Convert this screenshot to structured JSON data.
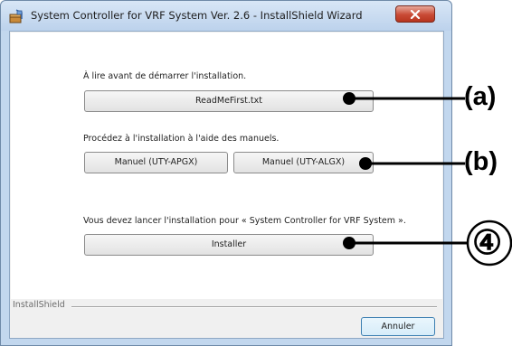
{
  "window": {
    "title": "System Controller for VRF System Ver. 2.6 - InstallShield Wizard"
  },
  "sections": {
    "readme_label": "À lire avant de démarrer l'installation.",
    "readme_button": "ReadMeFirst.txt",
    "manuals_label": "Procédez à l'installation à l'aide des manuels.",
    "manual_apgx_button": "Manuel (UTY-APGX)",
    "manual_algx_button": "Manuel (UTY-ALGX)",
    "install_label": "Vous devez lancer l'installation pour « System Controller for VRF System ».",
    "install_button": "Installer"
  },
  "footer": {
    "brand": "InstallShield",
    "cancel_button": "Annuler"
  },
  "annotations": {
    "a": "(a)",
    "b": "(b)",
    "c": "④"
  },
  "icons": {
    "app": "installer-box-icon",
    "close": "close-icon"
  }
}
